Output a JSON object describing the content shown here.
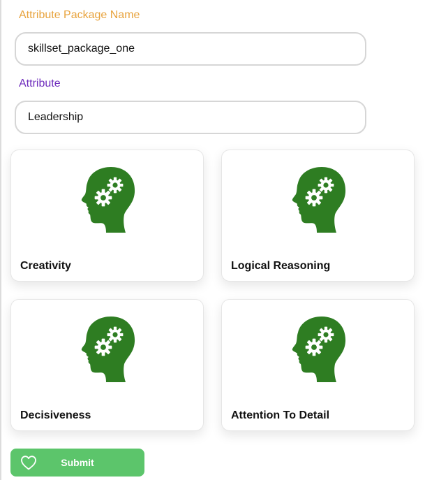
{
  "form": {
    "package_name": {
      "label": "Attribute Package Name",
      "value": "skillset_package_one",
      "label_color": "#e8a33d"
    },
    "attribute": {
      "label": "Attribute",
      "value": "Leadership",
      "label_color": "#6f2dbd"
    }
  },
  "attribute_cards": [
    {
      "title": "Creativity",
      "icon": "head-gears-icon"
    },
    {
      "title": "Logical Reasoning",
      "icon": "head-gears-icon"
    },
    {
      "title": "Decisiveness",
      "icon": "head-gears-icon"
    },
    {
      "title": "Attention To Detail",
      "icon": "head-gears-icon"
    }
  ],
  "submit": {
    "label": "Submit",
    "icon": "heart-outline-icon",
    "color": "#5cc56b"
  },
  "colors": {
    "icon_green": "#2e7d22",
    "card_border": "#e6e6e6",
    "input_border": "#d6d6d6"
  }
}
